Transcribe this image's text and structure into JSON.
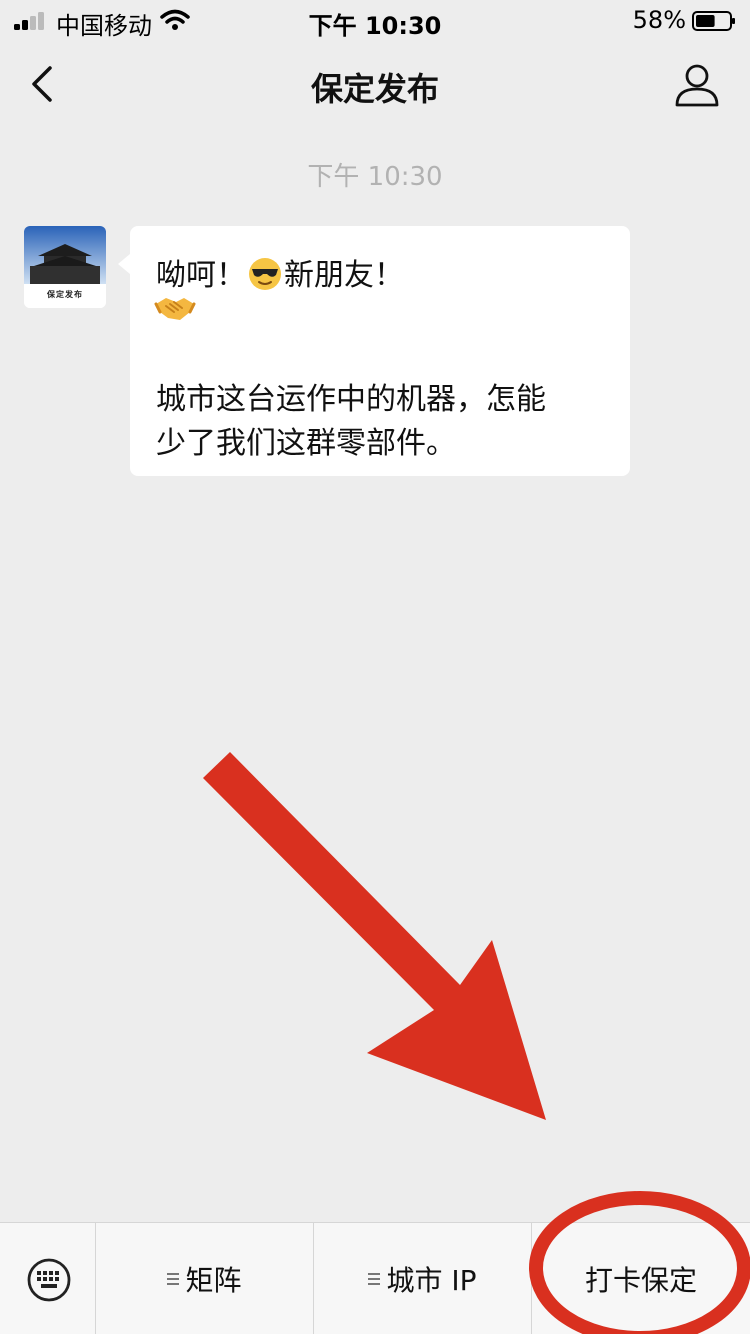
{
  "status_bar": {
    "carrier": "中国移动",
    "time": "下午 10:30",
    "battery_percent": "58%",
    "battery_level": 0.58
  },
  "nav": {
    "title": "保定发布"
  },
  "chat": {
    "timestamp": "下午 10:30",
    "message": {
      "greeting_prefix": "呦呵！",
      "greeting_suffix": "新朋友！",
      "emoji_1": "sunglasses-emoji",
      "emoji_2": "handshake-emoji",
      "body_line_1": "城市这台运作中的机器，怎能",
      "body_line_2": "少了我们这群零部件。"
    },
    "avatar_caption": "保定发布"
  },
  "menu": {
    "items": [
      {
        "label": "矩阵"
      },
      {
        "label": "城市 IP"
      },
      {
        "label": "打卡保定"
      }
    ]
  },
  "colors": {
    "background": "#ededed",
    "annotation_red": "#d9301f"
  }
}
